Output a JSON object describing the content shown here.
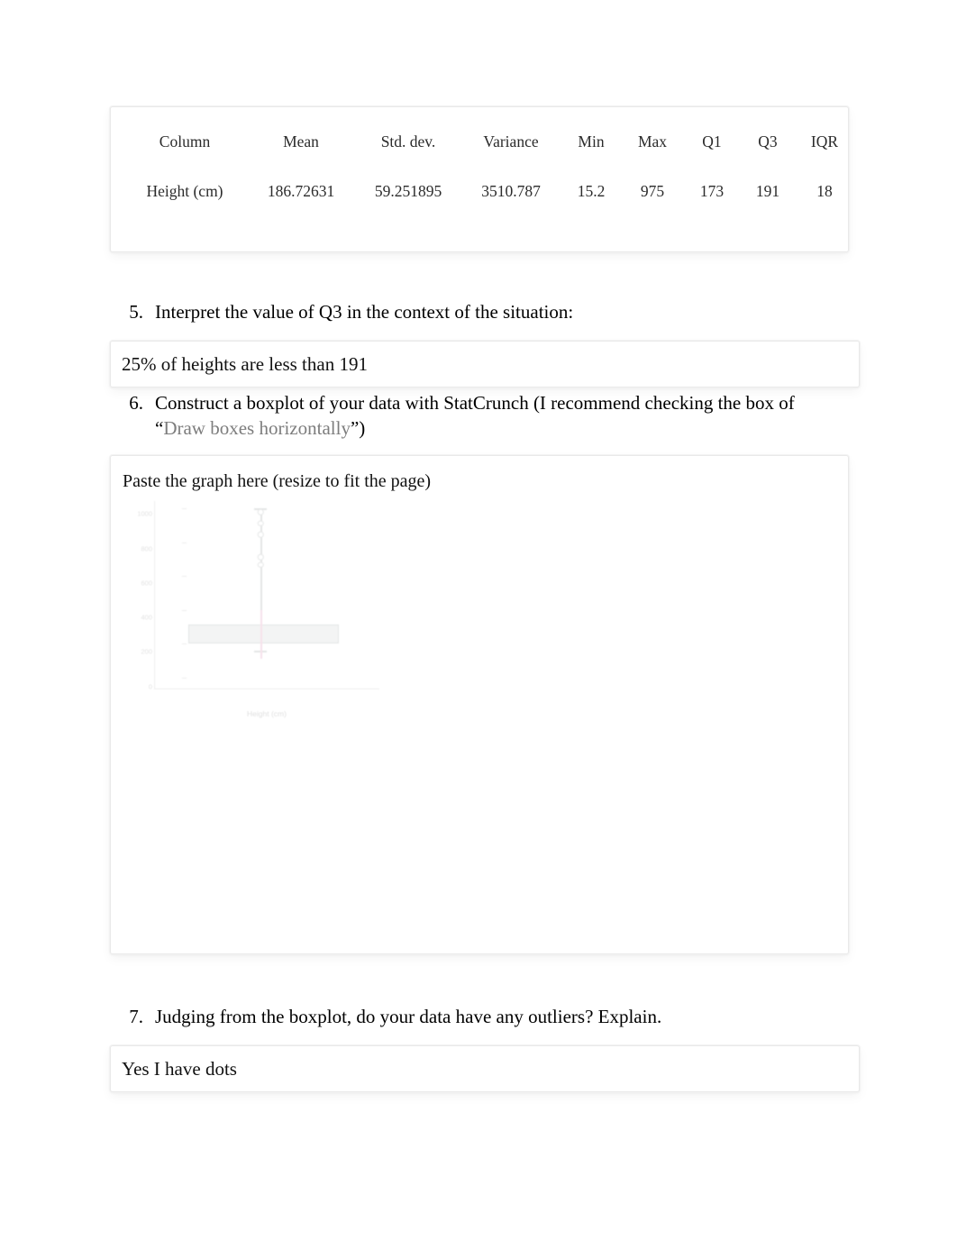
{
  "document": {
    "page_background": "#ffffff",
    "body_font_color": "#000000",
    "muted_color": "#7d7d7d"
  },
  "stats_table": {
    "name": "summary-statistics-table",
    "headers": [
      "Column",
      "Mean",
      "Std. dev.",
      "Variance",
      "Min",
      "Max",
      "Q1",
      "Q3",
      "IQR"
    ],
    "rows": [
      {
        "column": "Height (cm)",
        "mean": "186.72631",
        "std_dev": "59.251895",
        "variance": "3510.787",
        "min": "15.2",
        "max": "975",
        "q1": "173",
        "q3": "191",
        "iqr": "18"
      }
    ]
  },
  "questions": [
    {
      "number": "5.",
      "text": "Interpret the value of Q3 in the context of the situation:",
      "answer": "25% of heights are less than 191"
    },
    {
      "number": "6.",
      "text_before": "Construct a boxplot of your data with StatCrunch (I recommend checking the box of “",
      "text_muted": "Draw boxes horizontally",
      "text_after": "”)",
      "graph_prompt": "Paste the graph here (resize to fit the page)"
    },
    {
      "number": "7.",
      "text": "Judging from the boxplot, do your data have any outliers? Explain.",
      "answer": "Yes I have dots"
    }
  ],
  "chart_data": {
    "type": "boxplot",
    "title": "",
    "orientation": "horizontal",
    "xlabel": "Height (cm)",
    "ylabel": "",
    "ylim": [
      0,
      1000
    ],
    "yticks": [
      "1000",
      "800",
      "600",
      "400",
      "200",
      "0"
    ],
    "grid": false,
    "legend": false,
    "faded": true,
    "opacity": 0.16,
    "series": [
      {
        "name": "Height (cm)",
        "min": 15.2,
        "q1": 173,
        "median": 186.72631,
        "q3": 191,
        "max": 975,
        "iqr": 18,
        "outliers": [
          975,
          820,
          640,
          300,
          250
        ]
      }
    ],
    "colors": {
      "box_fill": "#b6bdbd",
      "box_stroke": "#5f6a6a",
      "median": "#d14f8c",
      "axis": "#9a9a9a"
    }
  }
}
